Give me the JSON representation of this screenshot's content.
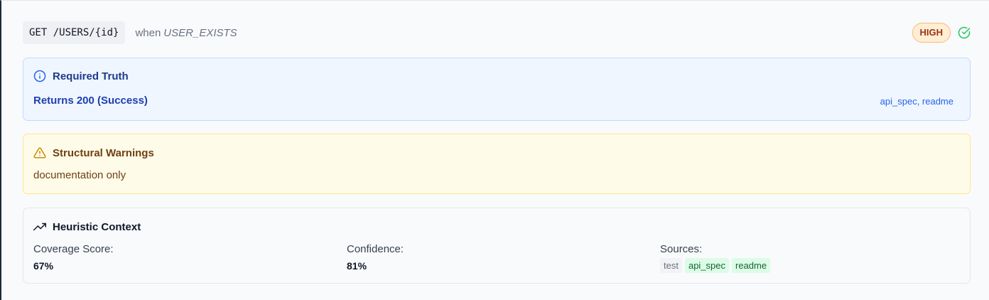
{
  "rule": {
    "method_path": "GET /USERS/{id}",
    "when_prefix": "when",
    "condition": "USER_EXISTS",
    "severity": "HIGH",
    "status_icon": "check-circle-icon"
  },
  "required_truth": {
    "title": "Required Truth",
    "icon": "info-circle-icon",
    "text": "Returns 200 (Success)",
    "sources": "api_spec, readme"
  },
  "structural_warnings": {
    "title": "Structural Warnings",
    "icon": "warning-triangle-icon",
    "text": "documentation only"
  },
  "heuristic_context": {
    "title": "Heuristic Context",
    "icon": "trending-up-icon",
    "coverage_label": "Coverage Score:",
    "coverage_value": "67%",
    "confidence_label": "Confidence:",
    "confidence_value": "81%",
    "sources_label": "Sources:",
    "sources": [
      "test",
      "api_spec",
      "readme"
    ]
  },
  "colors": {
    "info_blue": "#1e40af",
    "warning_amber": "#ca8a04",
    "success_green": "#22c55e",
    "high_badge": "#ffedd5"
  }
}
